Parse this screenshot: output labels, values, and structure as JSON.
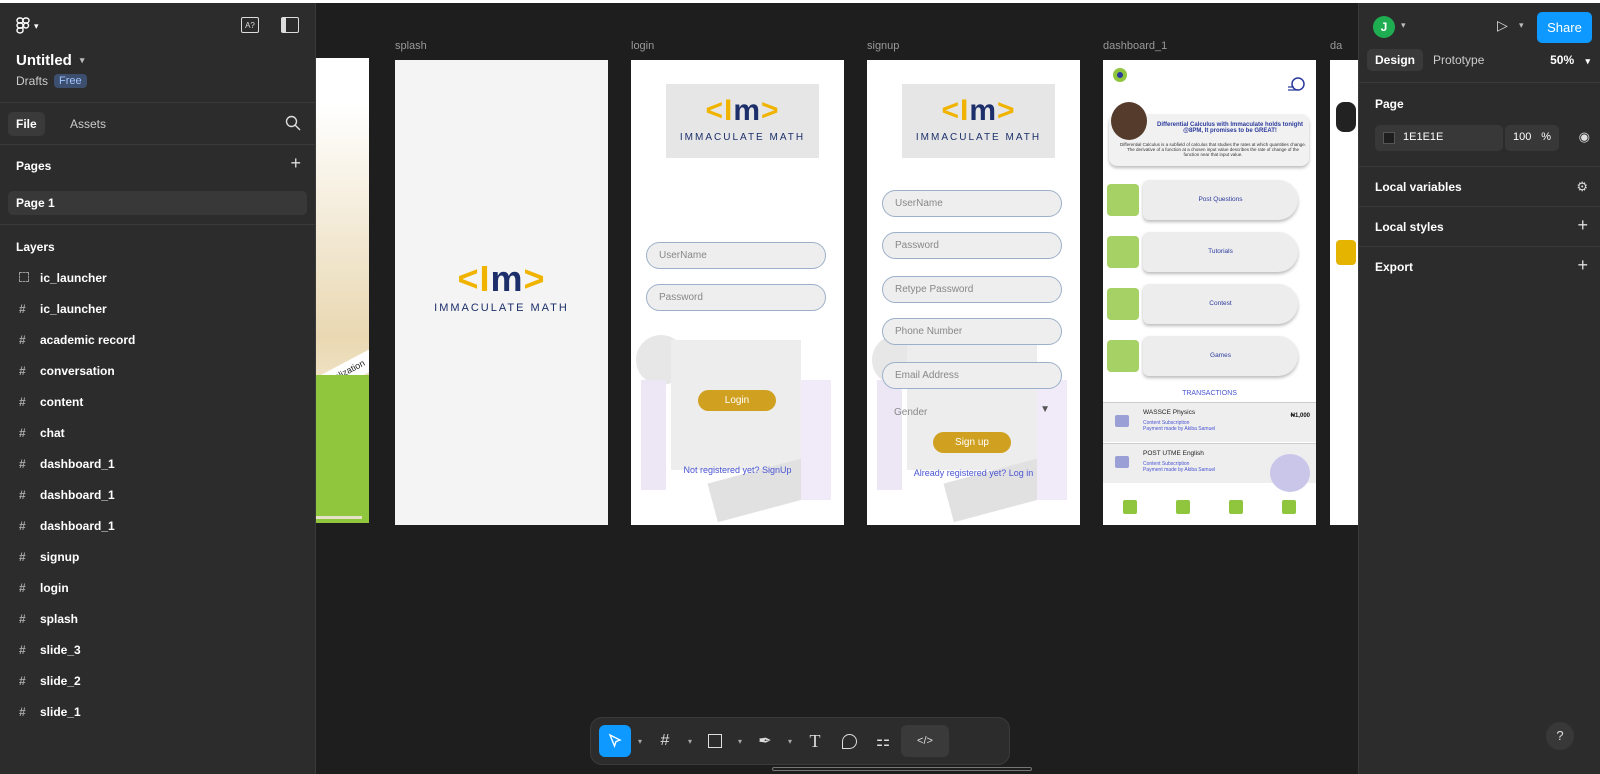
{
  "file": {
    "title": "Untitled",
    "location": "Drafts",
    "plan": "Free"
  },
  "left_panel": {
    "tabs": [
      "File",
      "Assets"
    ],
    "pages_title": "Pages",
    "pages": [
      "Page 1"
    ],
    "layers_title": "Layers",
    "layers": [
      "ic_launcher",
      "ic_launcher",
      "academic record",
      "conversation",
      "content",
      "chat",
      "dashboard_1",
      "dashboard_1",
      "dashboard_1",
      "signup",
      "login",
      "splash",
      "slide_3",
      "slide_2",
      "slide_1"
    ]
  },
  "canvas": {
    "frames": [
      "splash",
      "login",
      "signup",
      "dashboard_1",
      "da"
    ],
    "slide_text": "socialization",
    "logo": {
      "mark_left": "<I",
      "mark_mid": "m",
      "mark_right": ">",
      "text": "IMMACULATE MATH"
    },
    "login": {
      "username": "UserName",
      "password": "Password",
      "button": "Login",
      "link": "Not registered yet? SignUp"
    },
    "signup": {
      "username": "UserName",
      "password": "Password",
      "retype": "Retype Password",
      "phone": "Phone Number",
      "email": "Email Address",
      "gender": "Gender",
      "button": "Sign up",
      "link": "Already registered yet? Log in"
    },
    "dashboard": {
      "headline": "Differential Calculus with Immaculate holds tonight @8PM, It promises to be GREAT!",
      "body": "Differential Calculus is a subfield of calculus that studies the rates at which quantities change. The derivative of a function at a chosen input value describes the rate of change of the function near that input value.",
      "menu": [
        "Post Questions",
        "Tutorials",
        "Contest",
        "Games"
      ],
      "transactions_title": "TRANSACTIONS",
      "transactions": [
        {
          "title": "WASSCE Physics",
          "sub": "Content Subscription",
          "sub2": "Payment made by Akiba Samuel",
          "amount": "₦1,000"
        },
        {
          "title": "POST UTME English",
          "sub": "Content Subscription",
          "sub2": "Payment made by Akiba Samuel",
          "amount": ""
        }
      ]
    }
  },
  "toolbar": {
    "items": [
      "move-tool",
      "frame-tool",
      "shape-tool",
      "pen-tool",
      "text-tool",
      "comment-tool",
      "actions-tool",
      "dev-mode"
    ]
  },
  "right_panel": {
    "avatar": "J",
    "share": "Share",
    "tabs": [
      "Design",
      "Prototype"
    ],
    "zoom": "50%",
    "page_title": "Page",
    "bg_color": "1E1E1E",
    "opacity": "100",
    "opacity_unit": "%",
    "sections": [
      "Local variables",
      "Local styles",
      "Export"
    ]
  },
  "help": "?"
}
